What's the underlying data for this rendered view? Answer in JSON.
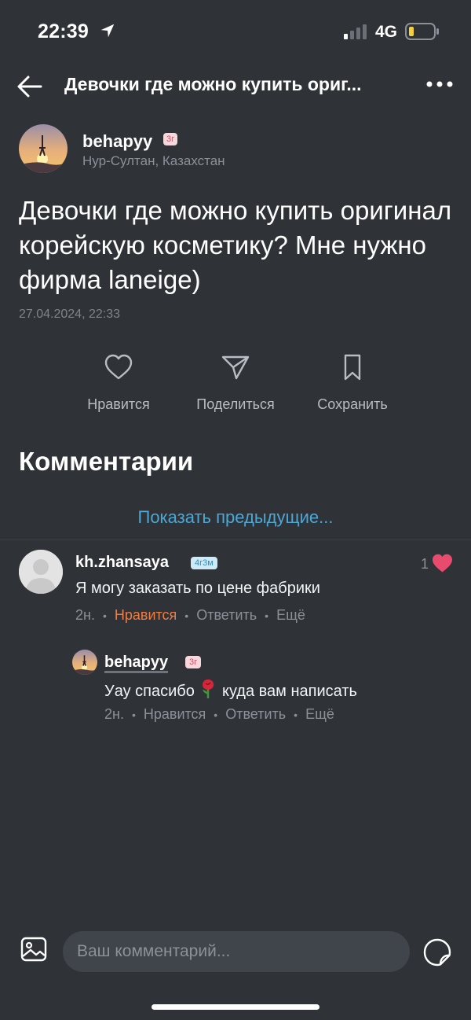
{
  "status_bar": {
    "time": "22:39",
    "network": "4G"
  },
  "top_bar": {
    "title": "Девочки где можно купить ориг..."
  },
  "post": {
    "author": "behapyy",
    "author_badge": "3г",
    "location": "Нур-Султан, Казахстан",
    "text": "Девочки где можно купить оригинал корейскую косметику? Мне нужно фирма laneige)",
    "timestamp": "27.04.2024, 22:33"
  },
  "actions": {
    "like": "Нравится",
    "share": "Поделиться",
    "save": "Сохранить"
  },
  "comments_section": {
    "heading": "Комментарии",
    "show_previous": "Показать предыдущие..."
  },
  "comments": [
    {
      "author": "kh.zhansaya",
      "badge": "4г3м",
      "text": "Я могу заказать по цене фабрики",
      "time": "2н.",
      "like_label": "Нравится",
      "reply_label": "Ответить",
      "more_label": "Ещё",
      "like_count": "1"
    },
    {
      "author": "behapyy",
      "badge": "3г",
      "text_before": "Уау спасибо",
      "text_after": "куда вам написать",
      "time": "2н.",
      "like_label": "Нравится",
      "reply_label": "Ответить",
      "more_label": "Ещё"
    }
  ],
  "composer": {
    "placeholder": "Ваш комментарий..."
  },
  "colors": {
    "background": "#2f3338",
    "link": "#4ca7d4",
    "liked": "#ef7d43",
    "heart": "#e94b6e"
  },
  "icons": [
    "location-arrow-icon",
    "signal-icon",
    "battery-icon",
    "back-arrow-icon",
    "more-icon",
    "heart-icon",
    "send-icon",
    "bookmark-icon",
    "image-icon",
    "sticker-icon",
    "rose-emoji-icon"
  ]
}
